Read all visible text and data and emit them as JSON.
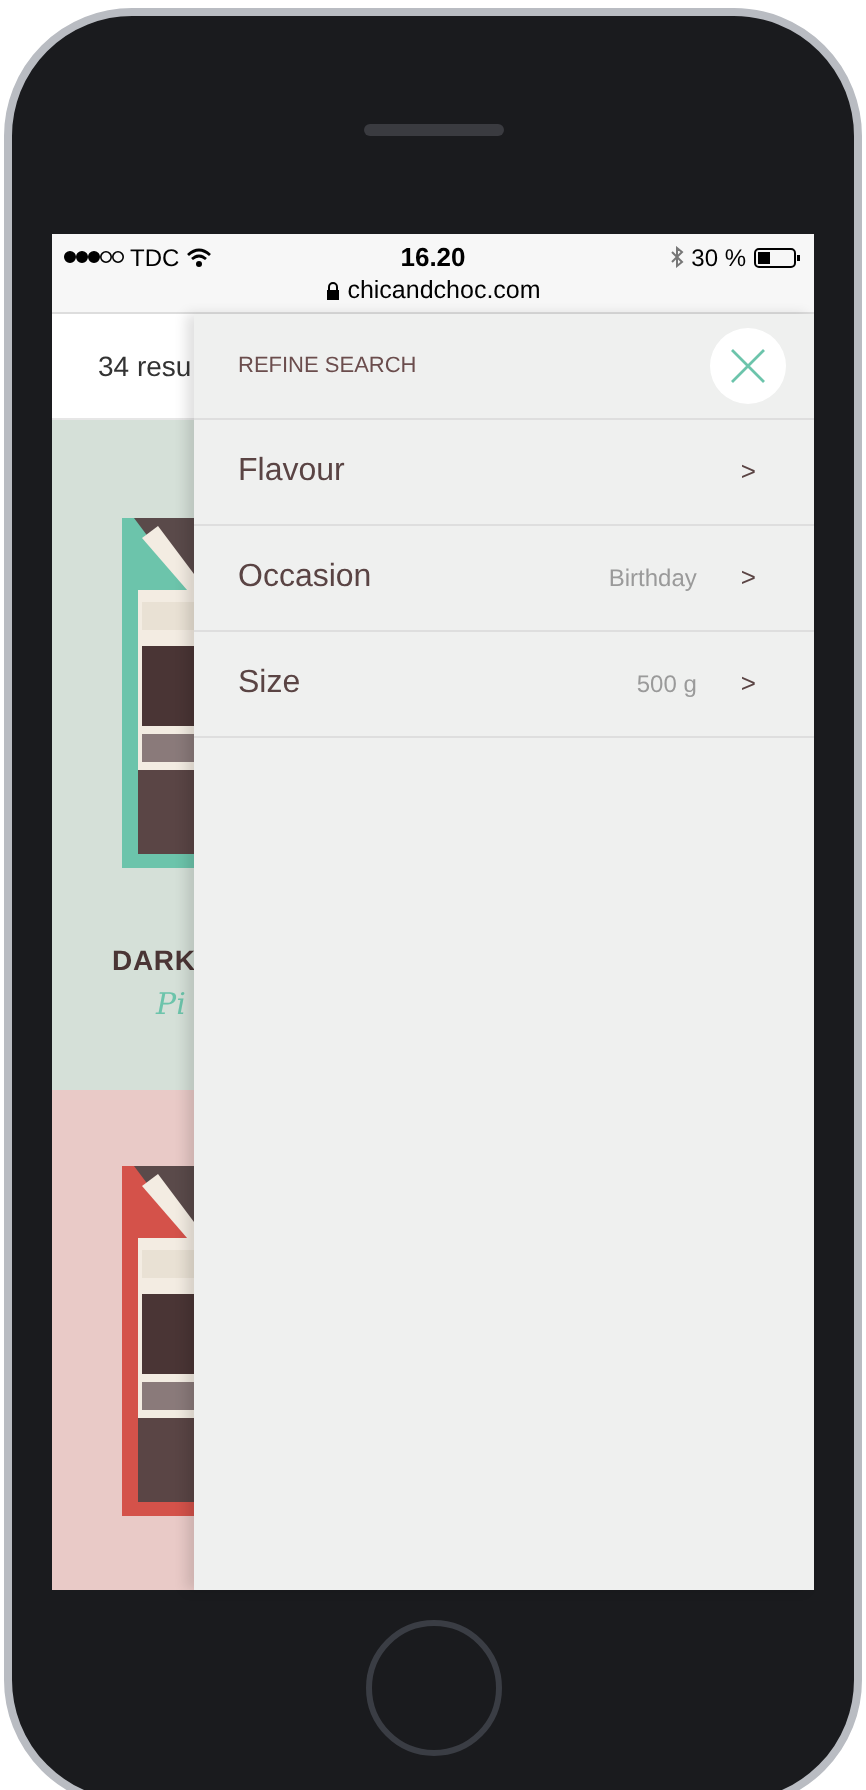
{
  "status_bar": {
    "carrier": "TDC",
    "time": "16.20",
    "battery": "30 %",
    "url": "chicandchoc.com"
  },
  "results": {
    "count": "34 resu"
  },
  "products": [
    {
      "name": "DARK",
      "subtitle": "Pi",
      "color": "#d5e0d8"
    },
    {
      "color": "#e9cac7"
    }
  ],
  "refine_panel": {
    "title": "REFINE SEARCH",
    "filters": [
      {
        "label": "Flavour",
        "chevron": ">"
      },
      {
        "label": "Occasion",
        "value": "Birthday",
        "chevron": ">"
      },
      {
        "label": "Size",
        "value": "500 g",
        "chevron": ">"
      }
    ]
  }
}
